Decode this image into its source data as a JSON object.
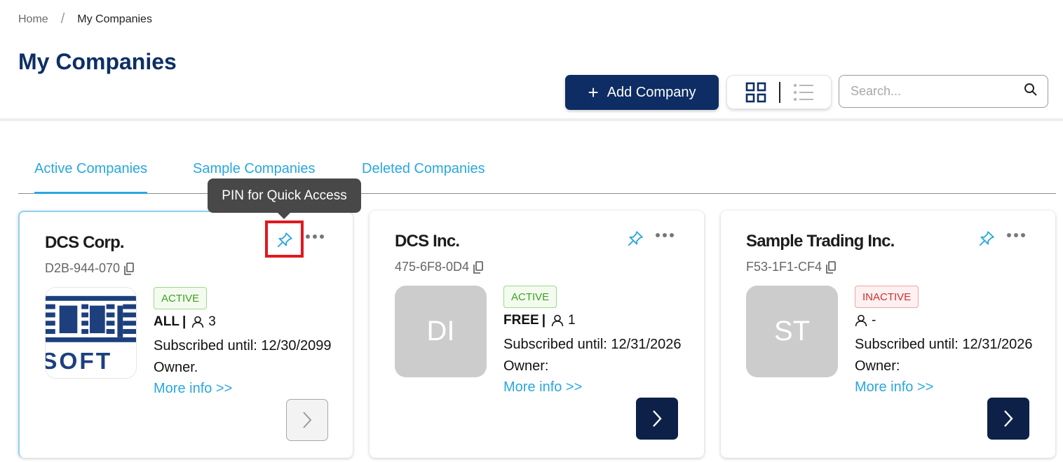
{
  "breadcrumb": {
    "home": "Home",
    "separator": "/",
    "current": "My Companies"
  },
  "page": {
    "title": "My Companies"
  },
  "toolbar": {
    "add_label": "Add Company",
    "add_icon": "plus-icon",
    "view_grid_icon": "grid-view-icon",
    "view_list_icon": "list-view-icon",
    "search_placeholder": "Search...",
    "search_value": ""
  },
  "tabs": [
    {
      "label": "Active Companies",
      "active": true
    },
    {
      "label": "Sample Companies",
      "active": false
    },
    {
      "label": "Deleted Companies",
      "active": false
    }
  ],
  "tooltip": {
    "text": "PIN for Quick Access"
  },
  "companies": [
    {
      "name": "DCS Corp.",
      "code": "D2B-944-070",
      "avatar": "",
      "logo": "QI SOFT logo",
      "status": "ACTIVE",
      "plan": "ALL",
      "users": "3",
      "subscribed": "Subscribed until: 12/30/2099",
      "owner": "Owner.",
      "more_info": "More info >>"
    },
    {
      "name": "DCS Inc.",
      "code": "475-6F8-0D4",
      "avatar": "DI",
      "status": "ACTIVE",
      "plan": "FREE",
      "users": "1",
      "subscribed": "Subscribed until: 12/31/2026",
      "owner": "Owner:",
      "more_info": "More info >>"
    },
    {
      "name": "Sample Trading Inc.",
      "code": "F53-1F1-CF4",
      "avatar": "ST",
      "status": "INACTIVE",
      "plan": "",
      "users": "-",
      "subscribed": "Subscribed until: 12/31/2026",
      "owner": "Owner:",
      "more_info": "More info >>"
    }
  ],
  "colors": {
    "brand_navy": "#0d2d64",
    "accent_blue": "#2aa7df",
    "active_green": "#3ea11f",
    "inactive_red": "#d32f2f",
    "highlight_red": "#e0191e"
  }
}
